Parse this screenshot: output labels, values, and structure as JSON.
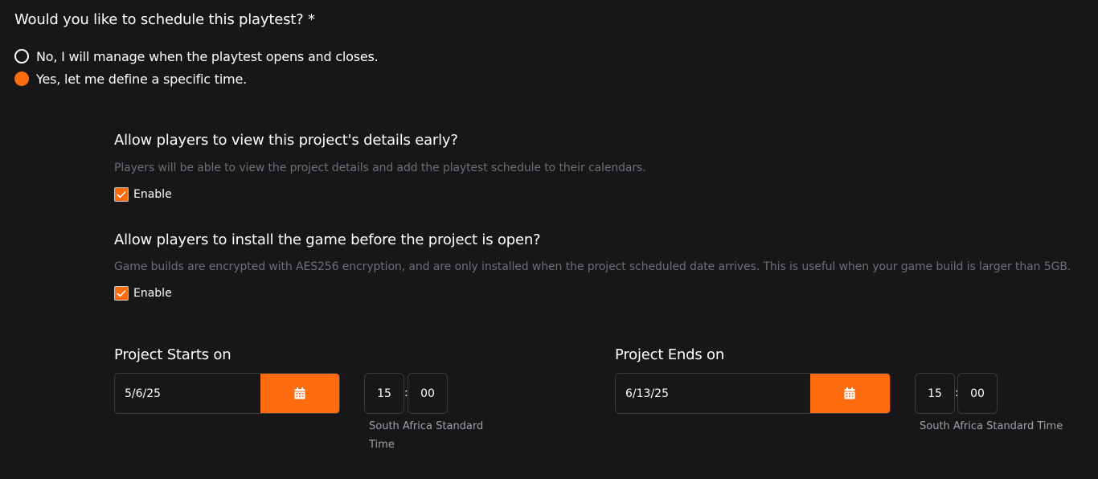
{
  "question": {
    "text": "Would you like to schedule this playtest? *"
  },
  "schedule_options": [
    {
      "label": "No, I will manage when the playtest opens and closes.",
      "selected": false
    },
    {
      "label": "Yes, let me define a specific time.",
      "selected": true
    }
  ],
  "early_view": {
    "title": "Allow players to view this project's details early?",
    "description": "Players will be able to view the project details and add the playtest schedule to their calendars.",
    "checkbox_label": "Enable",
    "checked": true
  },
  "early_install": {
    "title": "Allow players to install the game before the project is open?",
    "description": "Game builds are encrypted with AES256 encryption, and are only installed when the project scheduled date arrives. This is useful when your game build is larger than 5GB.",
    "checkbox_label": "Enable",
    "checked": true
  },
  "start": {
    "label": "Project Starts on",
    "date": "5/6/25",
    "hour": "15",
    "minute": "00",
    "separator": ":",
    "timezone": "South Africa Standard Time"
  },
  "end": {
    "label": "Project Ends on",
    "date": "6/13/25",
    "hour": "15",
    "minute": "00",
    "separator": ":",
    "timezone": "South Africa Standard Time"
  },
  "colors": {
    "accent": "#ff6b0f",
    "background": "#17171a",
    "muted_text": "#6e6e73",
    "border": "#3a3a3e"
  },
  "icons": {
    "calendar": "calendar-icon",
    "check": "check-icon"
  }
}
